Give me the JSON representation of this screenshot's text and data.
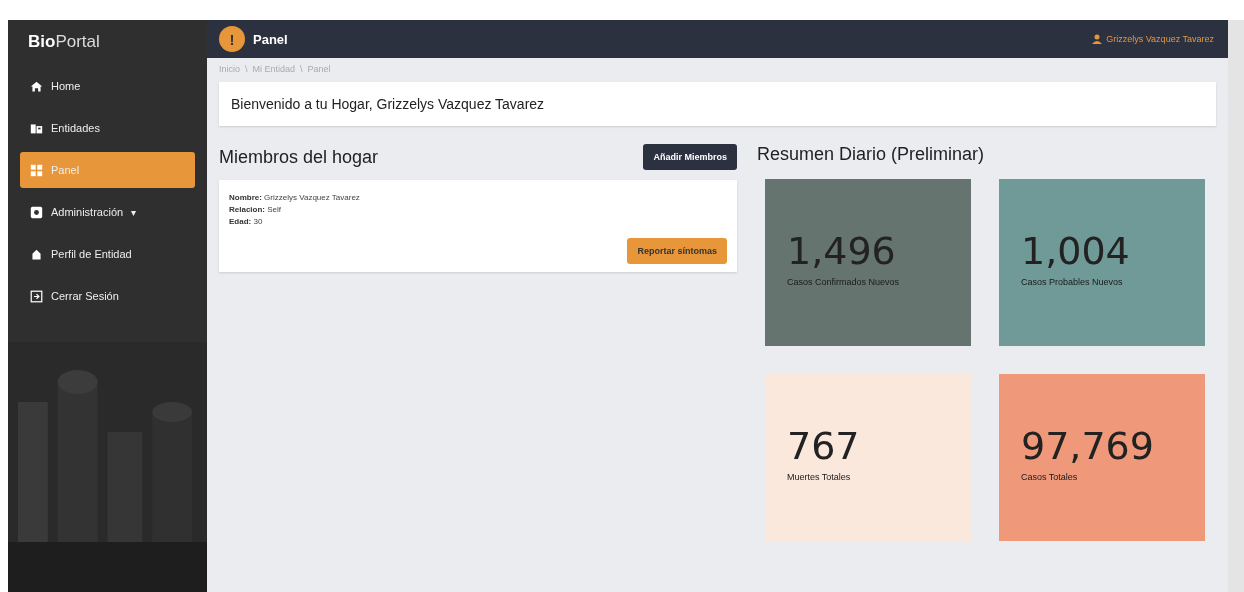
{
  "sidebar": {
    "logo_bold": "Bio",
    "logo_rest": "Portal",
    "items": [
      {
        "label": "Home",
        "kind": "home",
        "selected": false
      },
      {
        "label": "Entidades",
        "kind": "building",
        "selected": false
      },
      {
        "label": "Panel",
        "kind": "grid",
        "selected": true
      },
      {
        "label": "Administración",
        "kind": "gear",
        "selected": false,
        "caret": "▾"
      },
      {
        "label": "Perfil de Entidad",
        "kind": "house",
        "selected": false
      },
      {
        "label": "Cerrar Sesión",
        "kind": "exit",
        "selected": false
      }
    ]
  },
  "topbar": {
    "badge": "!",
    "title": "Panel",
    "user": "Grizzelys Vazquez Tavarez"
  },
  "breadcrumb": [
    "Inicio",
    "Mi Entidad",
    "Panel"
  ],
  "breadcrumb_separator": "\\",
  "welcome": "Bienvenido a tu Hogar, Grizzelys Vazquez Tavarez",
  "members": {
    "title": "Miembros del hogar",
    "add_button": "Añadir Miembros",
    "cards": [
      {
        "fields": [
          {
            "label": "Nombre:",
            "value": "Grizzelys Vazquez Tavarez"
          },
          {
            "label": "Relacion:",
            "value": "Self"
          },
          {
            "label": "Edad:",
            "value": "30"
          }
        ],
        "button": "Reportar síntomas"
      }
    ]
  },
  "summary": {
    "title": "Resumen Diario (Preliminar)",
    "tiles": [
      {
        "value": "1,496",
        "label": "Casos Confirmados Nuevos",
        "color": "#667470"
      },
      {
        "value": "1,004",
        "label": "Casos Probables Nuevos",
        "color": "#6f9a98"
      },
      {
        "value": "767",
        "label": "Muertes Totales",
        "color": "#fbe8dc"
      },
      {
        "value": "97,769",
        "label": "Casos Totales",
        "color": "#f0997a"
      }
    ]
  }
}
